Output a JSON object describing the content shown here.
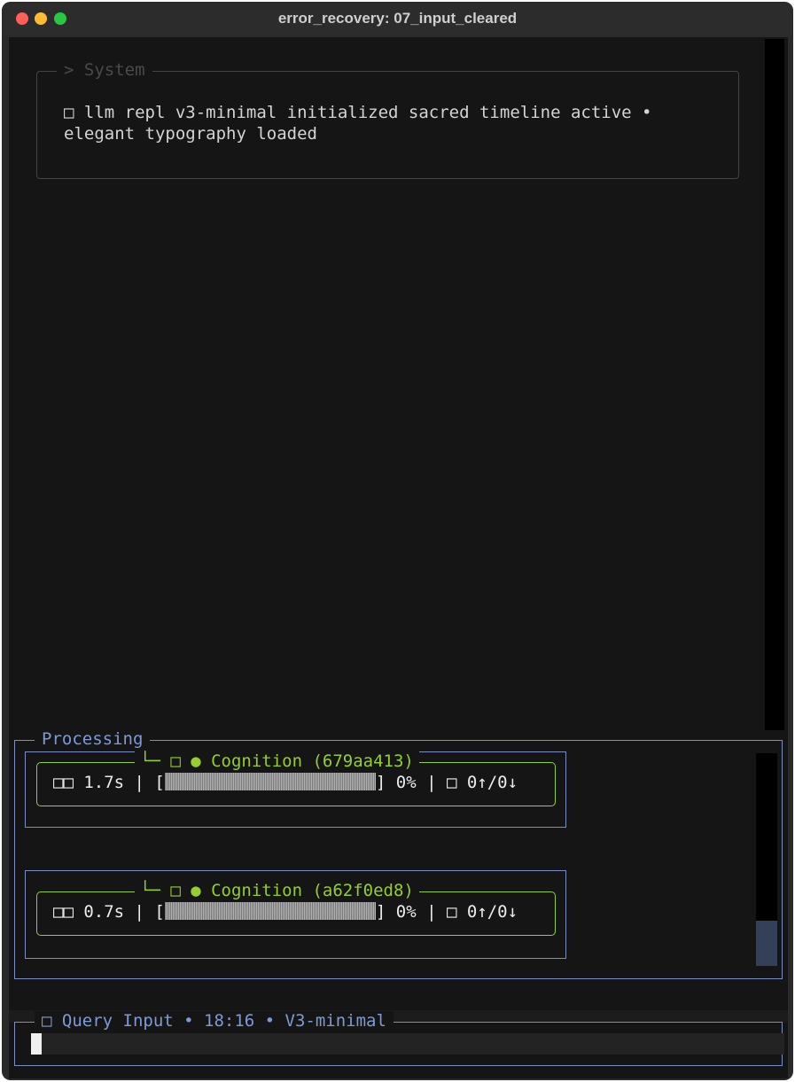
{
  "window": {
    "title": "error_recovery: 07_input_cleared"
  },
  "system_panel": {
    "legend": "> System",
    "message": "□ llm repl v3-minimal initialized sacred timeline active • elegant typography loaded"
  },
  "processing_panel": {
    "legend": "Processing",
    "cognitions": [
      {
        "legend": "└─ □ ● Cognition (679aa413)",
        "timer": "□□ 1.7s",
        "progress_percent": "0%",
        "progress_value": 0,
        "tokens": "□ 0↑/0↓"
      },
      {
        "legend": "└─ □ ● Cognition (a62f0ed8)",
        "timer": "□□ 0.7s",
        "progress_percent": "0%",
        "progress_value": 0,
        "tokens": "□ 0↑/0↓"
      }
    ]
  },
  "query_input": {
    "legend": "□ Query Input • 18:16 • V3-minimal",
    "value": ""
  },
  "colors": {
    "background": "#151515",
    "panel_border": "#7a8ec4",
    "cognition_green": "#94cf2e",
    "legend_blue": "#7e9ad6"
  }
}
